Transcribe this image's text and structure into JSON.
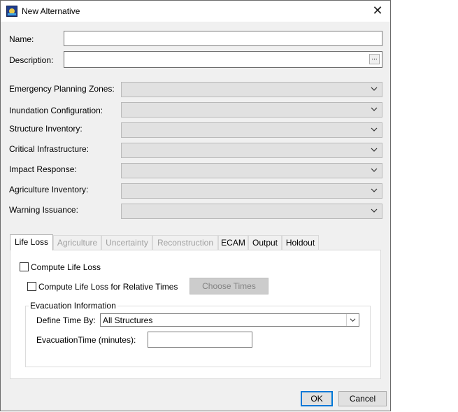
{
  "window": {
    "title": "New Alternative"
  },
  "form": {
    "name_label": "Name:",
    "name_value": "",
    "description_label": "Description:",
    "description_value": "",
    "ellipsis_label": "...",
    "combos": [
      {
        "label": "Emergency Planning Zones:",
        "value": ""
      },
      {
        "label": "Inundation Configuration:",
        "value": ""
      },
      {
        "label": "Structure Inventory:",
        "value": ""
      },
      {
        "label": "Critical Infrastructure:",
        "value": ""
      },
      {
        "label": "Impact Response:",
        "value": ""
      },
      {
        "label": "Agriculture Inventory:",
        "value": ""
      },
      {
        "label": "Warning Issuance:",
        "value": ""
      }
    ]
  },
  "tabs": [
    {
      "label": "Life Loss",
      "state": "active"
    },
    {
      "label": "Agriculture",
      "state": "disabled"
    },
    {
      "label": "Uncertainty",
      "state": "disabled"
    },
    {
      "label": "Reconstruction",
      "state": "disabled"
    },
    {
      "label": "ECAM",
      "state": "enabled"
    },
    {
      "label": "Output",
      "state": "enabled"
    },
    {
      "label": "Holdout",
      "state": "enabled"
    }
  ],
  "life_loss": {
    "compute_label": "Compute Life Loss",
    "compute_checked": false,
    "relative_label": "Compute Life Loss for Relative Times",
    "relative_checked": false,
    "choose_times_label": "Choose Times",
    "evac_group_title": "Evacuation Information",
    "define_time_label": "Define Time By:",
    "define_time_value": "All Structures",
    "evac_time_label": "EvacuationTime (minutes):",
    "evac_time_value": ""
  },
  "buttons": {
    "ok": "OK",
    "cancel": "Cancel"
  },
  "icons": {
    "app": "app-icon",
    "close": "close-icon",
    "dropdown": "chevron-down-icon"
  },
  "colors": {
    "default_button_border": "#0078d7",
    "disabled_text": "#a0a0a0"
  }
}
